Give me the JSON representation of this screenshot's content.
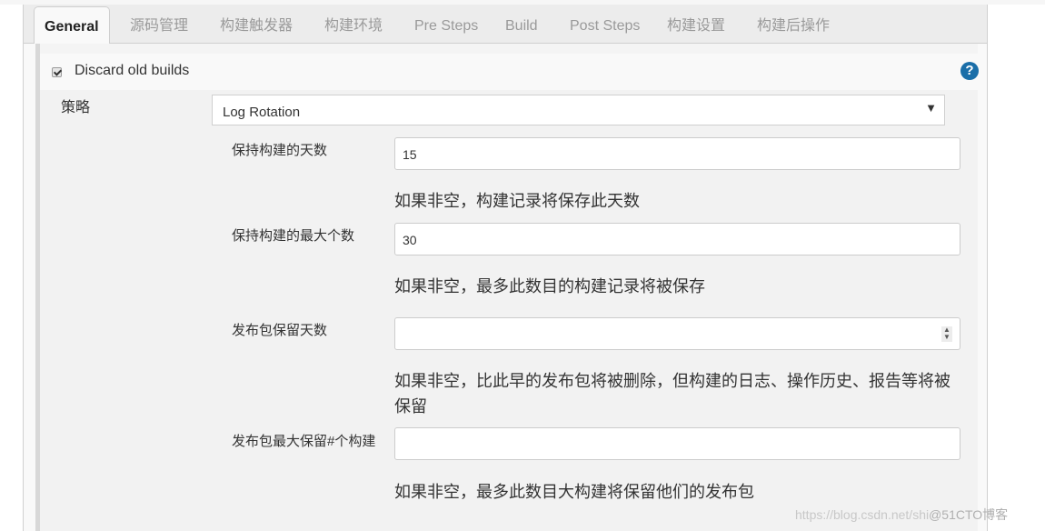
{
  "tabs": [
    {
      "label": "General",
      "active": true
    },
    {
      "label": "源码管理"
    },
    {
      "label": "构建触发器"
    },
    {
      "label": "构建环境"
    },
    {
      "label": "Pre Steps"
    },
    {
      "label": "Build"
    },
    {
      "label": "Post Steps"
    },
    {
      "label": "构建设置"
    },
    {
      "label": "构建后操作"
    }
  ],
  "discard": {
    "label": "Discard old builds",
    "checked": true,
    "help_icon": "question-circle-icon",
    "help_glyph": "?"
  },
  "strategy": {
    "label": "策略",
    "selected": "Log Rotation",
    "arrow": "▼"
  },
  "fields": [
    {
      "label": "保持构建的天数",
      "value": "15",
      "hint": "如果非空，构建记录将保存此天数"
    },
    {
      "label": "保持构建的最大个数",
      "value": "30",
      "hint": "如果非空，最多此数目的构建记录将被保存"
    },
    {
      "label": "发布包保留天数",
      "value": "",
      "hint": "如果非空，比此早的发布包将被删除，但构建的日志、操作历史、报告等将被保留",
      "spinner": "▲▼"
    },
    {
      "label": "发布包最大保留#个构建",
      "value": "",
      "hint": "如果非空，最多此数目大构建将保留他们的发布包"
    }
  ],
  "watermark": {
    "url": "https://blog.csdn.net/shi",
    "brand": "@51CTO博客"
  }
}
